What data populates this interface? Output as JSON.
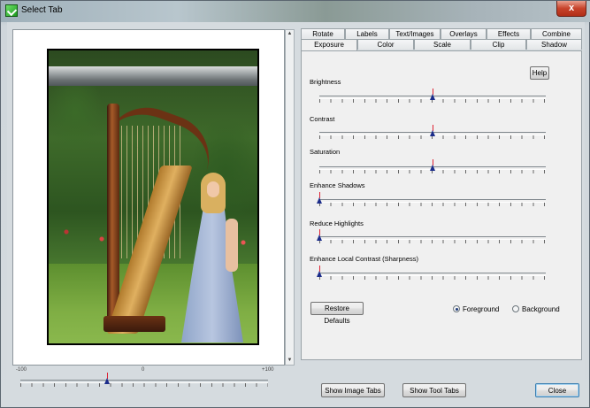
{
  "window": {
    "title": "Select Tab",
    "close_glyph": "x",
    "app_icon": "green-check-icon"
  },
  "zoom": {
    "min_label": "-100",
    "mid_label": "0",
    "max_label": "+100",
    "value": -30
  },
  "tabs": {
    "row1": [
      "Rotate",
      "Labels",
      "Text/Images",
      "Overlays",
      "Effects",
      "Combine"
    ],
    "row2": [
      "Exposure",
      "Color",
      "Scale",
      "Clip",
      "Shadow"
    ],
    "active": "Exposure"
  },
  "exposure": {
    "help_label": "Help",
    "sliders": [
      {
        "label": "Brightness",
        "value": 0.5
      },
      {
        "label": "Contrast",
        "value": 0.5
      },
      {
        "label": "Saturation",
        "value": 0.5
      },
      {
        "label": "Enhance Shadows",
        "value": 0.0
      },
      {
        "label": "Reduce Highlights",
        "value": 0.0
      },
      {
        "label": "Enhance Local Contrast (Sharpness)",
        "value": 0.0
      }
    ],
    "restore_label": "Restore Defaults",
    "radio_foreground": "Foreground",
    "radio_background": "Background",
    "selected_radio": "Foreground"
  },
  "footer": {
    "show_image_tabs": "Show Image Tabs",
    "show_tool_tabs": "Show Tool Tabs",
    "close": "Close"
  },
  "colors": {
    "thumb_marker": "#1b2c8a",
    "thumb_line": "#dd2233"
  }
}
